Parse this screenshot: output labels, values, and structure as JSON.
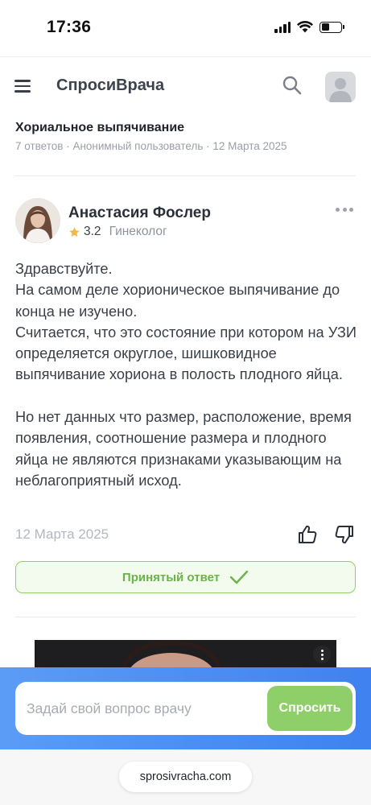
{
  "status_bar": {
    "time": "17:36"
  },
  "header": {
    "brand": "СпросиВрача"
  },
  "question": {
    "title": "Хориальное выпячивание",
    "meta": "7 ответов · Анонимный пользователь · 12 Марта 2025"
  },
  "answer": {
    "doctor_name": "Анастасия Фослер",
    "rating": "3.2",
    "specialty": "Гинеколог",
    "text": "Здравствуйте.\nНа самом деле хорионическое выпячивание до конца не изучено.\nСчитается, что это состояние при котором на УЗИ определяется округлое, шишковидное выпячивание хориона в полость плодного яйца.\n\nНо нет данных что размер, расположение, время появления, соотношение размера и плодного яйца не являются признаками указывающим на неблагоприятный исход.",
    "date": "12 Марта 2025",
    "accepted_label": "Принятый ответ"
  },
  "ask_bar": {
    "placeholder": "Задай свой вопрос врачу",
    "button_label": "Спросить"
  },
  "browser": {
    "url": "sprosivracha.com"
  },
  "colors": {
    "accent_green": "#8fcf6a",
    "accent_blue": "#4a8ff3",
    "star": "#f4b740"
  }
}
